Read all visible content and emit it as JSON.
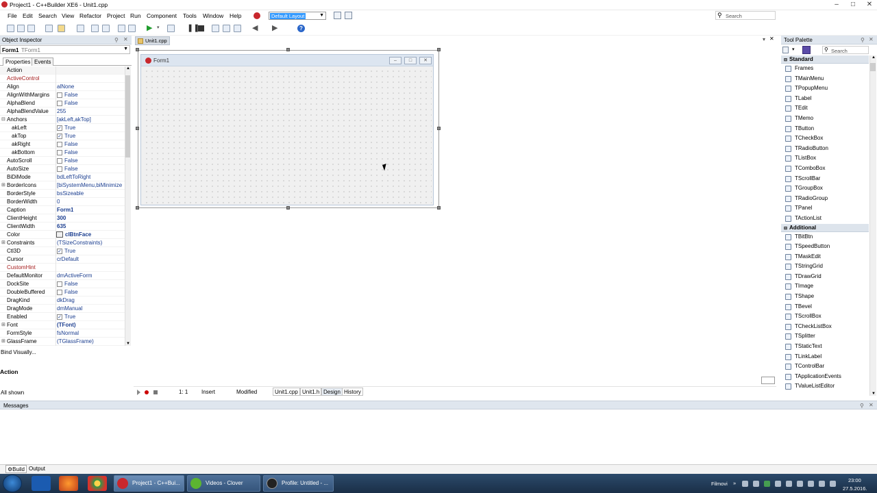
{
  "window": {
    "title": "Project1 - C++Builder XE6 - Unit1.cpp",
    "minimize": "–",
    "maximize": "□",
    "close": "✕"
  },
  "menu": [
    "File",
    "Edit",
    "Search",
    "View",
    "Refactor",
    "Project",
    "Run",
    "Component",
    "Tools",
    "Window",
    "Help"
  ],
  "layout_combo": {
    "value": "Default Layout"
  },
  "top_search": {
    "placeholder": "Search"
  },
  "object_inspector": {
    "title": "Object Inspector",
    "selected": "Form1",
    "selected_type": "TForm1",
    "tabs": [
      "Properties",
      "Events"
    ],
    "properties": [
      {
        "name": "Action",
        "value": "",
        "kind": "text",
        "hl": true
      },
      {
        "name": "ActiveControl",
        "value": "",
        "kind": "text",
        "red": true
      },
      {
        "name": "Align",
        "value": "alNone",
        "kind": "text"
      },
      {
        "name": "AlignWithMargins",
        "value": "False",
        "kind": "check",
        "checked": false
      },
      {
        "name": "AlphaBlend",
        "value": "False",
        "kind": "check",
        "checked": false
      },
      {
        "name": "AlphaBlendValue",
        "value": "255",
        "kind": "text"
      },
      {
        "name": "Anchors",
        "value": "[akLeft,akTop]",
        "kind": "text",
        "expander": "⊟"
      },
      {
        "name": "akLeft",
        "value": "True",
        "kind": "check",
        "checked": true,
        "sub": true
      },
      {
        "name": "akTop",
        "value": "True",
        "kind": "check",
        "checked": true,
        "sub": true
      },
      {
        "name": "akRight",
        "value": "False",
        "kind": "check",
        "checked": false,
        "sub": true
      },
      {
        "name": "akBottom",
        "value": "False",
        "kind": "check",
        "checked": false,
        "sub": true
      },
      {
        "name": "AutoScroll",
        "value": "False",
        "kind": "check",
        "checked": false
      },
      {
        "name": "AutoSize",
        "value": "False",
        "kind": "check",
        "checked": false
      },
      {
        "name": "BiDiMode",
        "value": "bdLeftToRight",
        "kind": "text"
      },
      {
        "name": "BorderIcons",
        "value": "[biSystemMenu,biMinimize",
        "kind": "text",
        "expander": "⊞"
      },
      {
        "name": "BorderStyle",
        "value": "bsSizeable",
        "kind": "text"
      },
      {
        "name": "BorderWidth",
        "value": "0",
        "kind": "text"
      },
      {
        "name": "Caption",
        "value": "Form1",
        "kind": "text",
        "bold": true
      },
      {
        "name": "ClientHeight",
        "value": "300",
        "kind": "text",
        "bold": true
      },
      {
        "name": "ClientWidth",
        "value": "635",
        "kind": "text",
        "bold": true
      },
      {
        "name": "Color",
        "value": "clBtnFace",
        "kind": "color",
        "bold": true
      },
      {
        "name": "Constraints",
        "value": "(TSizeConstraints)",
        "kind": "text",
        "expander": "⊞"
      },
      {
        "name": "Ctl3D",
        "value": "True",
        "kind": "check",
        "checked": true
      },
      {
        "name": "Cursor",
        "value": "crDefault",
        "kind": "text"
      },
      {
        "name": "CustomHint",
        "value": "",
        "kind": "text",
        "red": true
      },
      {
        "name": "DefaultMonitor",
        "value": "dmActiveForm",
        "kind": "text"
      },
      {
        "name": "DockSite",
        "value": "False",
        "kind": "check",
        "checked": false
      },
      {
        "name": "DoubleBuffered",
        "value": "False",
        "kind": "check",
        "checked": false
      },
      {
        "name": "DragKind",
        "value": "dkDrag",
        "kind": "text"
      },
      {
        "name": "DragMode",
        "value": "dmManual",
        "kind": "text"
      },
      {
        "name": "Enabled",
        "value": "True",
        "kind": "check",
        "checked": true
      },
      {
        "name": "Font",
        "value": "(TFont)",
        "kind": "text",
        "bold": true,
        "expander": "⊞"
      },
      {
        "name": "FormStyle",
        "value": "fsNormal",
        "kind": "text"
      },
      {
        "name": "GlassFrame",
        "value": "(TGlassFrame)",
        "kind": "text",
        "expander": "⊞"
      }
    ],
    "bind_visually": "Bind Visually...",
    "description": "Action",
    "filter": "All shown"
  },
  "editor": {
    "tab": "Unit1.cpp",
    "form_caption": "Form1",
    "status": {
      "position": "1:  1",
      "mode": "Insert",
      "state": "Modified"
    },
    "bottom_tabs": [
      "Unit1.cpp",
      "Unit1.h",
      "Design",
      "History"
    ]
  },
  "tool_palette": {
    "title": "Tool Palette",
    "search_placeholder": "Search",
    "categories": [
      {
        "name": "Standard",
        "items": [
          "Frames",
          "TMainMenu",
          "TPopupMenu",
          "TLabel",
          "TEdit",
          "TMemo",
          "TButton",
          "TCheckBox",
          "TRadioButton",
          "TListBox",
          "TComboBox",
          "TScrollBar",
          "TGroupBox",
          "TRadioGroup",
          "TPanel",
          "TActionList"
        ]
      },
      {
        "name": "Additional",
        "items": [
          "TBitBtn",
          "TSpeedButton",
          "TMaskEdit",
          "TStringGrid",
          "TDrawGrid",
          "TImage",
          "TShape",
          "TBevel",
          "TScrollBox",
          "TCheckListBox",
          "TSplitter",
          "TStaticText",
          "TLinkLabel",
          "TControlBar",
          "TApplicationEvents",
          "TValueListEditor"
        ]
      }
    ]
  },
  "messages": {
    "title": "Messages",
    "tabs": [
      "Build",
      "Output"
    ]
  },
  "taskbar": {
    "tasks": [
      "Project1 - C++Bui...",
      "Videos - Clover",
      "Profile: Untitled - ..."
    ],
    "tray_label": "Filmovi",
    "time": "23:00",
    "date": "27.5.2016."
  },
  "colors": {
    "accent": "#3399ff",
    "brand": "#c8272d",
    "panel_header": "#dfe6ee",
    "taskbar": "#1a2f47"
  }
}
